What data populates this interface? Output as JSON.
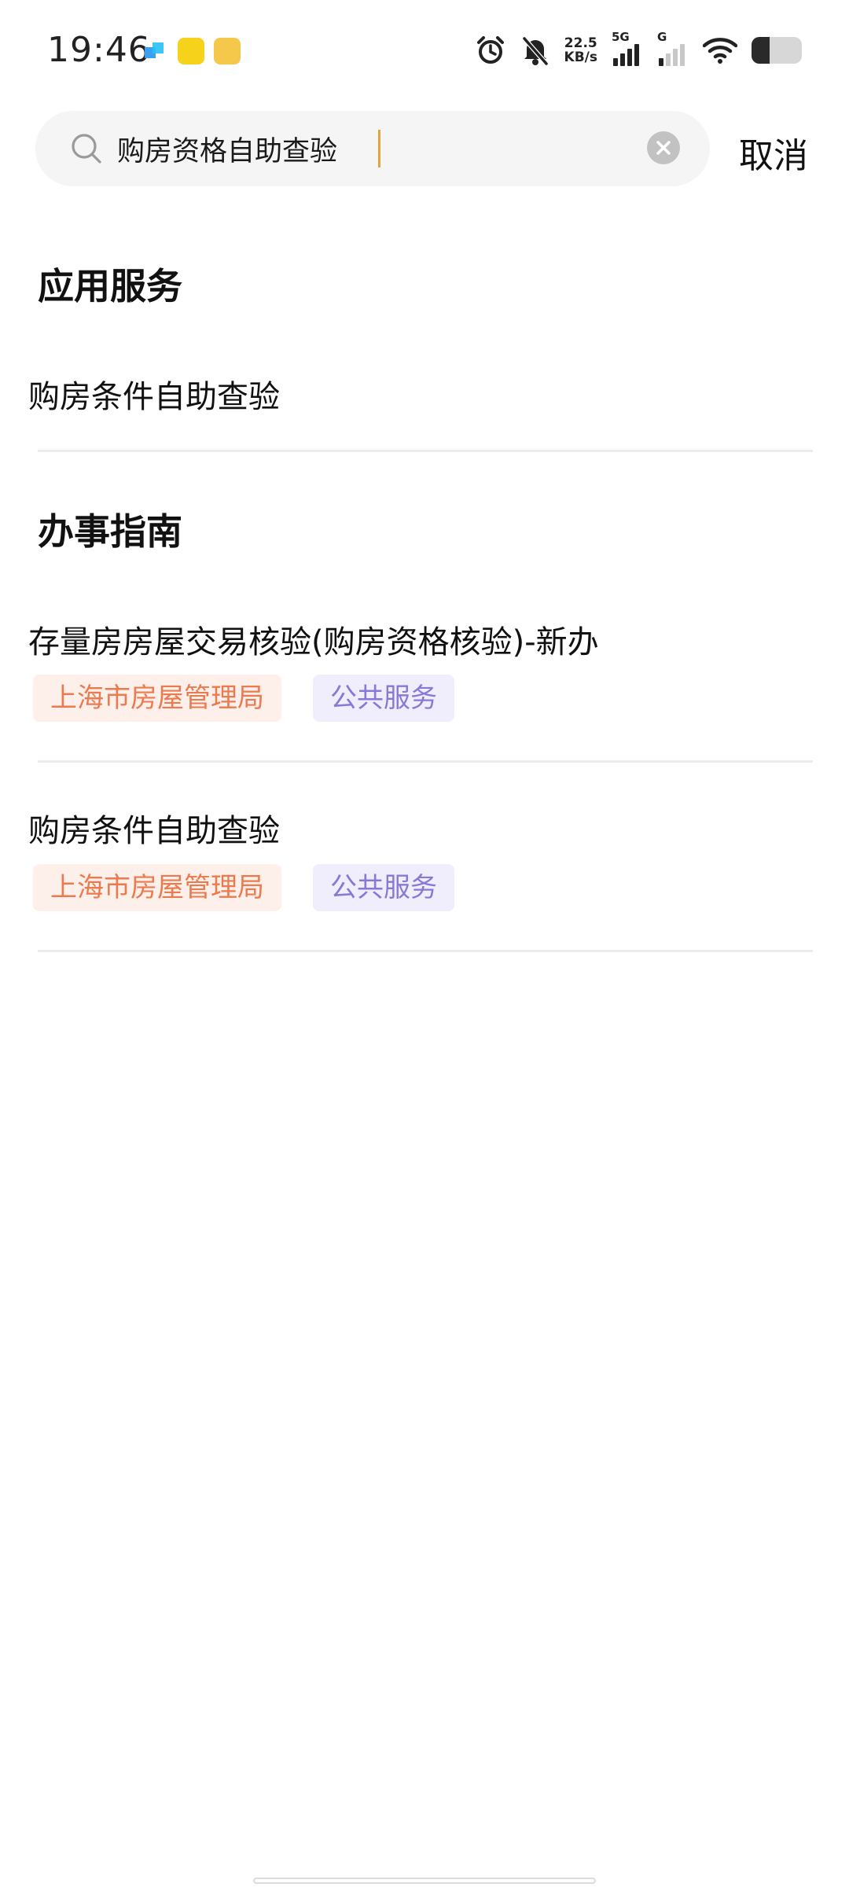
{
  "status_bar": {
    "time": "19:46",
    "net_speed_value": "22.5",
    "net_speed_unit": "KB/s",
    "sim1_label": "5G",
    "sim2_label": "G",
    "battery_level": 0.36
  },
  "search": {
    "query": "购房资格自助查验",
    "cancel_label": "取消"
  },
  "sections": {
    "app_services": {
      "title": "应用服务",
      "items": [
        {
          "title": "购房条件自助查验"
        }
      ]
    },
    "guides": {
      "title": "办事指南",
      "items": [
        {
          "title": "存量房房屋交易核验(购房资格核验)-新办",
          "org_tag": "上海市房屋管理局",
          "type_tag": "公共服务"
        },
        {
          "title": "购房条件自助查验",
          "org_tag": "上海市房屋管理局",
          "type_tag": "公共服务"
        }
      ]
    }
  },
  "colors": {
    "org_tag_text": "#ec7a4f",
    "org_tag_bg": "#fdf0ea",
    "type_tag_text": "#8a78d6",
    "type_tag_bg": "#f0edfc",
    "caret": "#e6a23c"
  }
}
